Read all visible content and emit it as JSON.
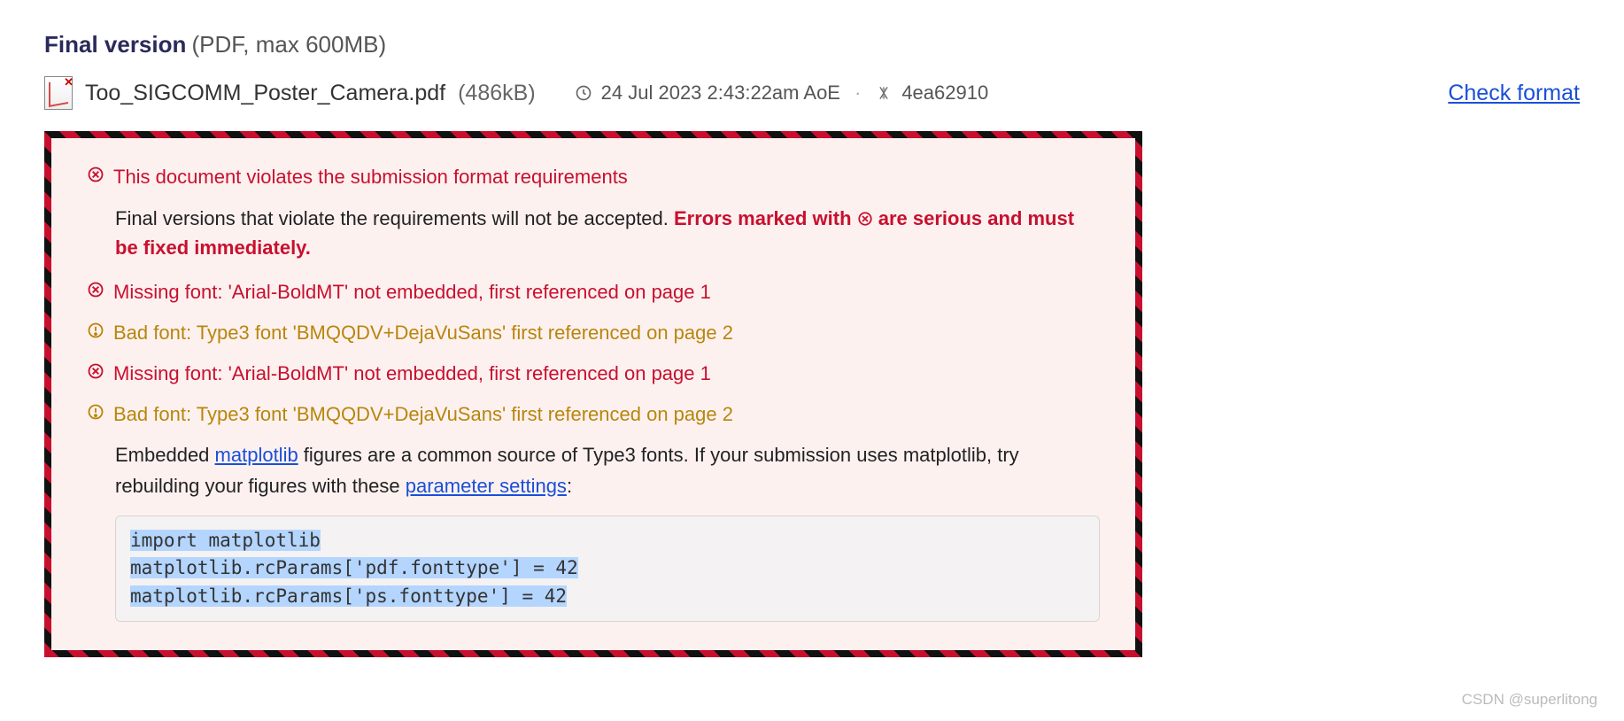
{
  "header": {
    "title": "Final version",
    "subtitle": "(PDF, max 600MB)"
  },
  "file": {
    "name": "Too_SIGCOMM_Poster_Camera.pdf",
    "size": "(486kB)",
    "uploaded": "24 Jul 2023 2:43:22am AoE",
    "hash": "4ea62910",
    "check_link": "Check format"
  },
  "errors": {
    "main_title": "This document violates the submission format requirements",
    "sub_plain": "Final versions that violate the requirements will not be accepted. ",
    "sub_bold_prefix": "Errors marked with ",
    "sub_bold_suffix": " are serious and must be fixed immediately.",
    "items": [
      {
        "severity": "error",
        "text": "Missing font: 'Arial-BoldMT' not embedded, first referenced on page 1"
      },
      {
        "severity": "warn",
        "text": "Bad font: Type3 font 'BMQQDV+DejaVuSans' first referenced on page 2"
      },
      {
        "severity": "error",
        "text": "Missing font: 'Arial-BoldMT' not embedded, first referenced on page 1"
      },
      {
        "severity": "warn",
        "text": "Bad font: Type3 font 'BMQQDV+DejaVuSans' first referenced on page 2"
      }
    ],
    "hint": {
      "pre": "Embedded ",
      "link1": "matplotlib",
      "mid": " figures are a common source of Type3 fonts. If your submission uses matplotlib, try rebuilding your figures with these ",
      "link2": "parameter settings",
      "post": ":"
    },
    "code": "import matplotlib\nmatplotlib.rcParams['pdf.fonttype'] = 42\nmatplotlib.rcParams['ps.fonttype'] = 42"
  },
  "watermark": "CSDN @superlitong"
}
